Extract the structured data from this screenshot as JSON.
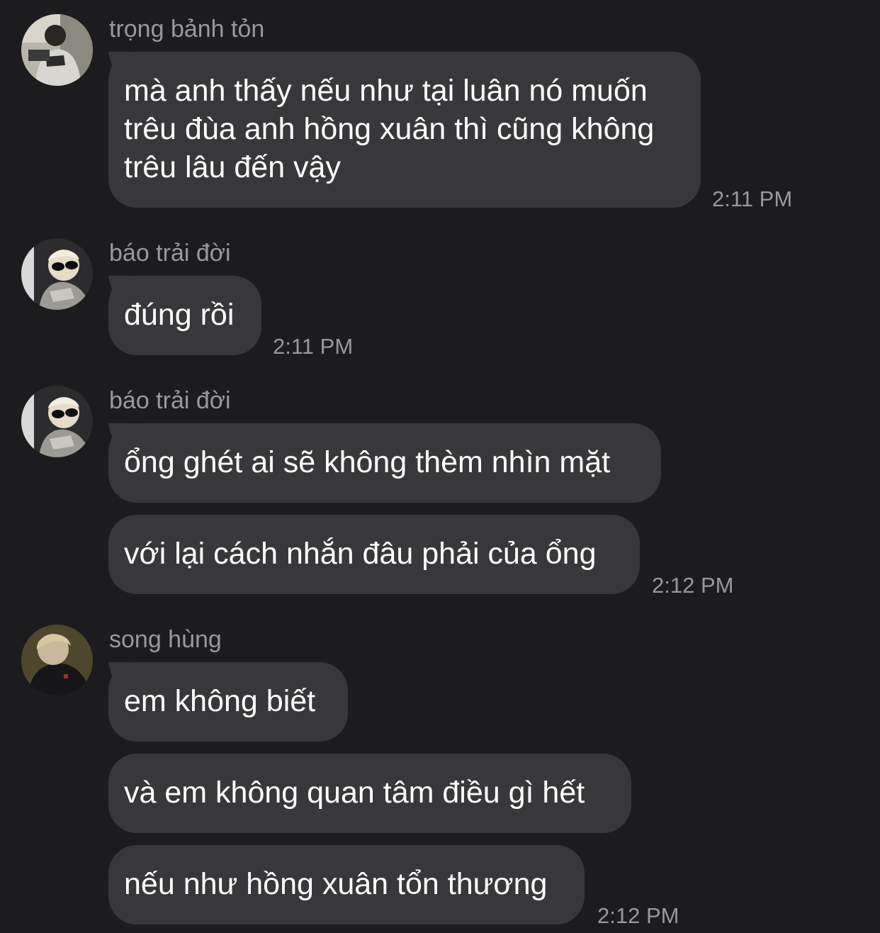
{
  "colors": {
    "background": "#1c1c1e",
    "bubble": "#38383a",
    "bubble_text": "#ffffff",
    "meta_text": "#98989e"
  },
  "messages": [
    {
      "sender": "trọng bảnh tỏn",
      "avatar": "photo-avatar-camera",
      "bubbles": [
        "mà anh thấy nếu như tại luân nó muốn trêu đùa anh hồng xuân thì cũng không trêu lâu đến vậy"
      ],
      "time": "2:11 PM"
    },
    {
      "sender": "báo trải đời",
      "avatar": "photo-avatar-sunglasses",
      "bubbles": [
        "đúng rồi"
      ],
      "time": "2:11 PM"
    },
    {
      "sender": "báo trải đời",
      "avatar": "photo-avatar-sunglasses",
      "bubbles": [
        "ổng ghét ai sẽ không thèm nhìn mặt",
        "với lại cách nhắn đâu phải của ổng"
      ],
      "time": "2:12 PM"
    },
    {
      "sender": "song hùng",
      "avatar": "photo-avatar-dark-jacket",
      "bubbles": [
        "em không biết",
        "và em không quan tâm điều gì hết",
        "nếu như hồng xuân tổn thương"
      ],
      "time": "2:12 PM"
    }
  ]
}
